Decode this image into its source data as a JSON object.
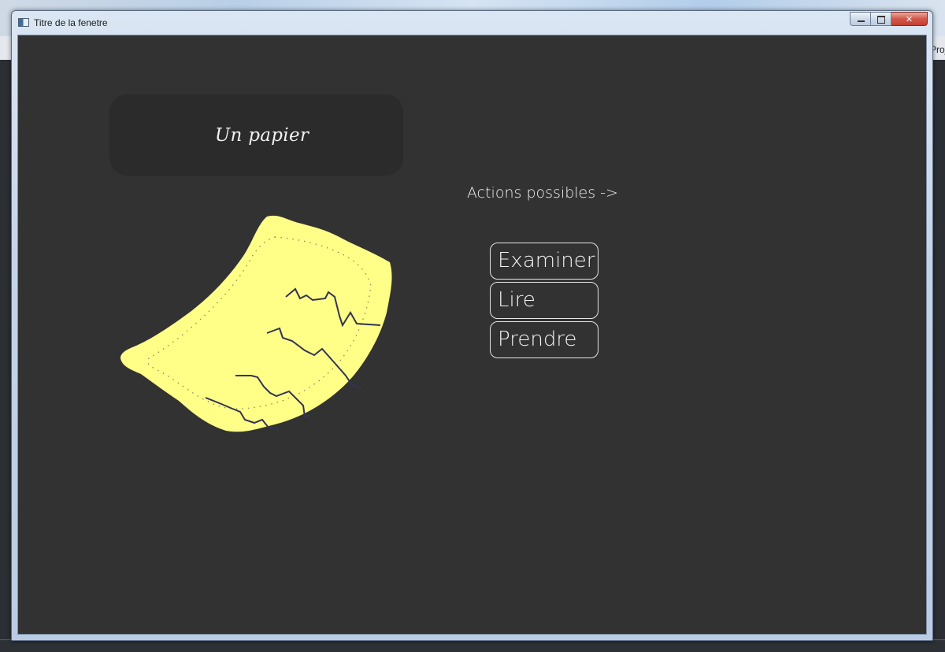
{
  "window": {
    "title": "Titre de la fenetre",
    "icons": {
      "app": "app-window-icon",
      "minimize": "minimize-icon",
      "maximize": "maximize-icon",
      "close": "close-icon"
    }
  },
  "background": {
    "partial_text": "Proj"
  },
  "item": {
    "name": "Un papier",
    "image": "paper-illustration",
    "paper_color": "#ffff88"
  },
  "actions": {
    "label": "Actions possibles ->",
    "buttons": [
      {
        "label": "Examiner"
      },
      {
        "label": "Lire"
      },
      {
        "label": "Prendre"
      }
    ]
  },
  "colors": {
    "client_background": "#323232",
    "name_panel": "#2b2b2b",
    "text": "#f2f2f2"
  }
}
